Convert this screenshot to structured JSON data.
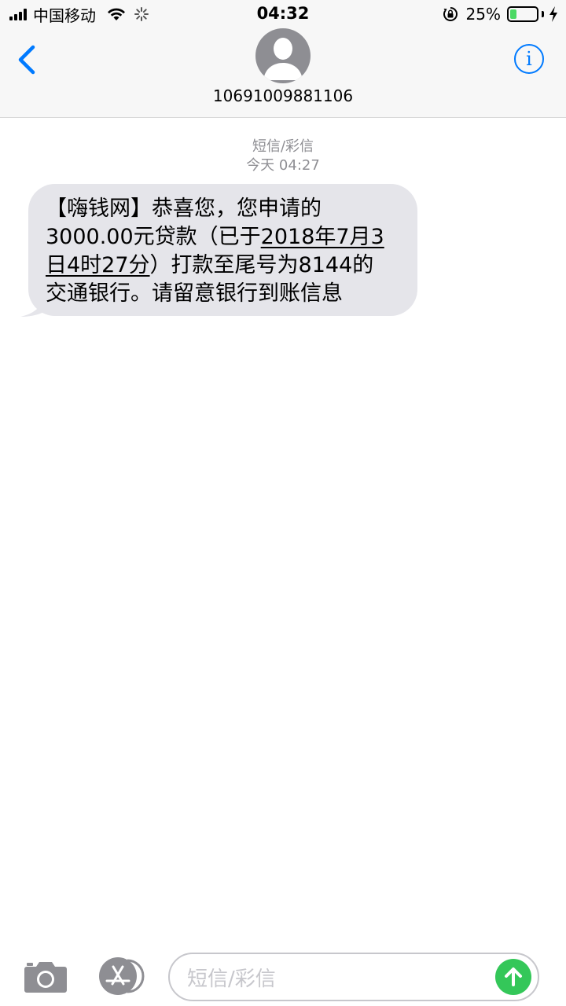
{
  "status_bar": {
    "carrier": "中国移动",
    "time": "04:32",
    "battery_percent": "25%",
    "battery_level": 0.25,
    "battery_fill_color": "#4cd964",
    "icons": [
      "signal-icon",
      "wifi-icon",
      "activity-spinner-icon",
      "rotation-lock-icon",
      "battery-icon",
      "charging-bolt-icon"
    ]
  },
  "header": {
    "contact": "10691009881106",
    "accent_color": "#007aff",
    "icons": [
      "back-chevron-icon",
      "contact-avatar-icon",
      "info-icon"
    ]
  },
  "conversation": {
    "message_type": "短信/彩信",
    "timestamp": "今天 04:27",
    "message": {
      "line1": "【嗨钱网】恭喜您，您申请的",
      "line2_pre": "3000.00元贷款（已于",
      "line2_link": "2018年7月3",
      "line3_link": "日4时27分",
      "line3_post": "）打款至尾号为8144的",
      "line4": "交通银行。请留意银行到账信息"
    },
    "bubble_color": "#e5e5ea"
  },
  "input_bar": {
    "placeholder": "短信/彩信",
    "send_color": "#34c759",
    "icons": [
      "camera-icon",
      "app-store-icon",
      "send-arrow-icon"
    ]
  }
}
